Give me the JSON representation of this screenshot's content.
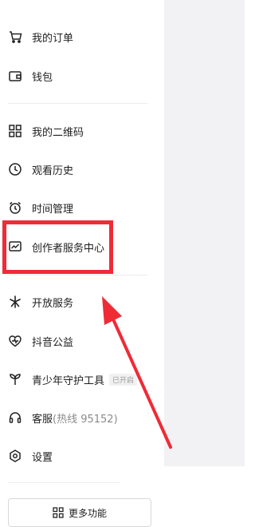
{
  "menu": {
    "orders": {
      "label": "我的订单",
      "icon": "cart-icon"
    },
    "wallet": {
      "label": "钱包",
      "icon": "wallet-icon"
    },
    "qrcode": {
      "label": "我的二维码",
      "icon": "qr-code-icon"
    },
    "history": {
      "label": "观看历史",
      "icon": "clock-icon"
    },
    "time_mgmt": {
      "label": "时间管理",
      "icon": "alarm-clock-icon"
    },
    "creator": {
      "label": "创作者服务中心",
      "icon": "chart-monitor-icon"
    },
    "open_services": {
      "label": "开放服务",
      "icon": "sparkle-icon"
    },
    "charity": {
      "label": "抖音公益",
      "icon": "heart-icon"
    },
    "youth": {
      "label": "青少年守护工具",
      "icon": "sprout-icon",
      "badge": "已开启"
    },
    "support": {
      "label": "客服",
      "sub": "(热线 95152)",
      "icon": "headset-icon"
    },
    "settings": {
      "label": "设置",
      "icon": "gear-icon"
    }
  },
  "more_button": {
    "label": "更多功能",
    "icon": "grid-icon"
  },
  "colors": {
    "highlight": "#ef2b36",
    "panel": "#f2f2f4"
  }
}
